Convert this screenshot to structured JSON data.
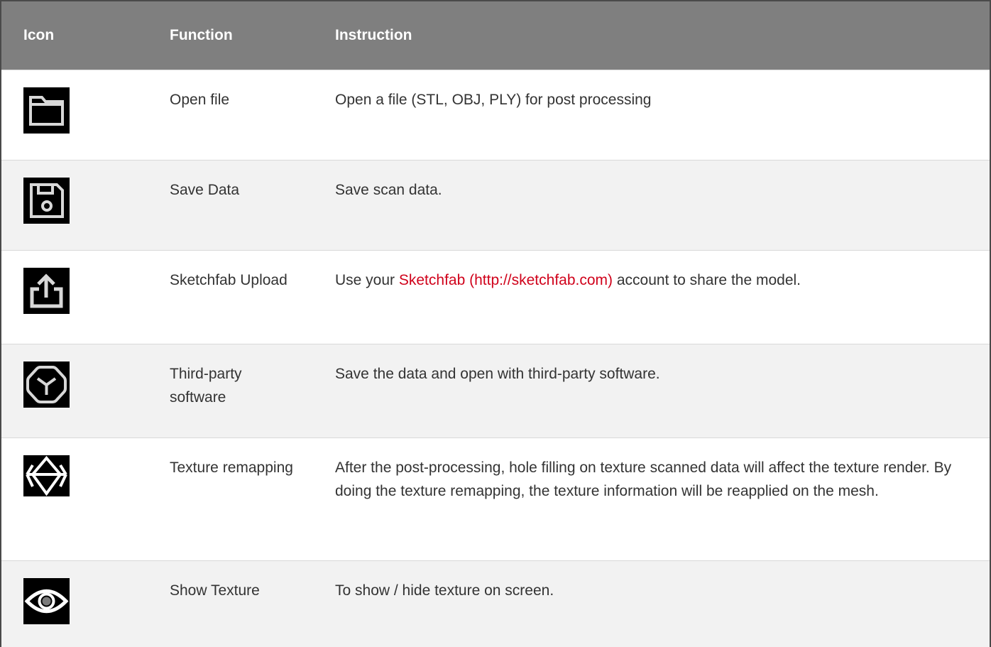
{
  "table": {
    "headers": {
      "icon": "Icon",
      "function": "Function",
      "instruction": "Instruction"
    },
    "rows": [
      {
        "icon": "folder-icon",
        "function": "Open file",
        "instruction": "Open a file (STL, OBJ, PLY) for post processing"
      },
      {
        "icon": "floppy-disk-icon",
        "function": "Save Data",
        "instruction": "Save scan data."
      },
      {
        "icon": "upload-icon",
        "function": "Sketchfab Upload",
        "instruction_before": "Use your ",
        "instruction_link": "Sketchfab (http://sketchfab.com)",
        "instruction_after": " account to share the model."
      },
      {
        "icon": "cube-icon",
        "function": "Third-party software",
        "instruction": "Save the data and open with third-party software."
      },
      {
        "icon": "texture-remap-icon",
        "function": "Texture remapping",
        "instruction": "After the post-processing, hole filling on texture scanned data will affect the texture render. By doing the texture remapping, the texture information will be reapplied on the mesh."
      },
      {
        "icon": "eye-icon",
        "function": "Show Texture",
        "instruction": "To show / hide texture on screen."
      }
    ]
  },
  "colors": {
    "header_bg": "#7f7f7f",
    "header_text": "#ffffff",
    "row_alt_bg": "#f2f2f2",
    "link": "#d0021b",
    "icon_bg": "#000000"
  }
}
